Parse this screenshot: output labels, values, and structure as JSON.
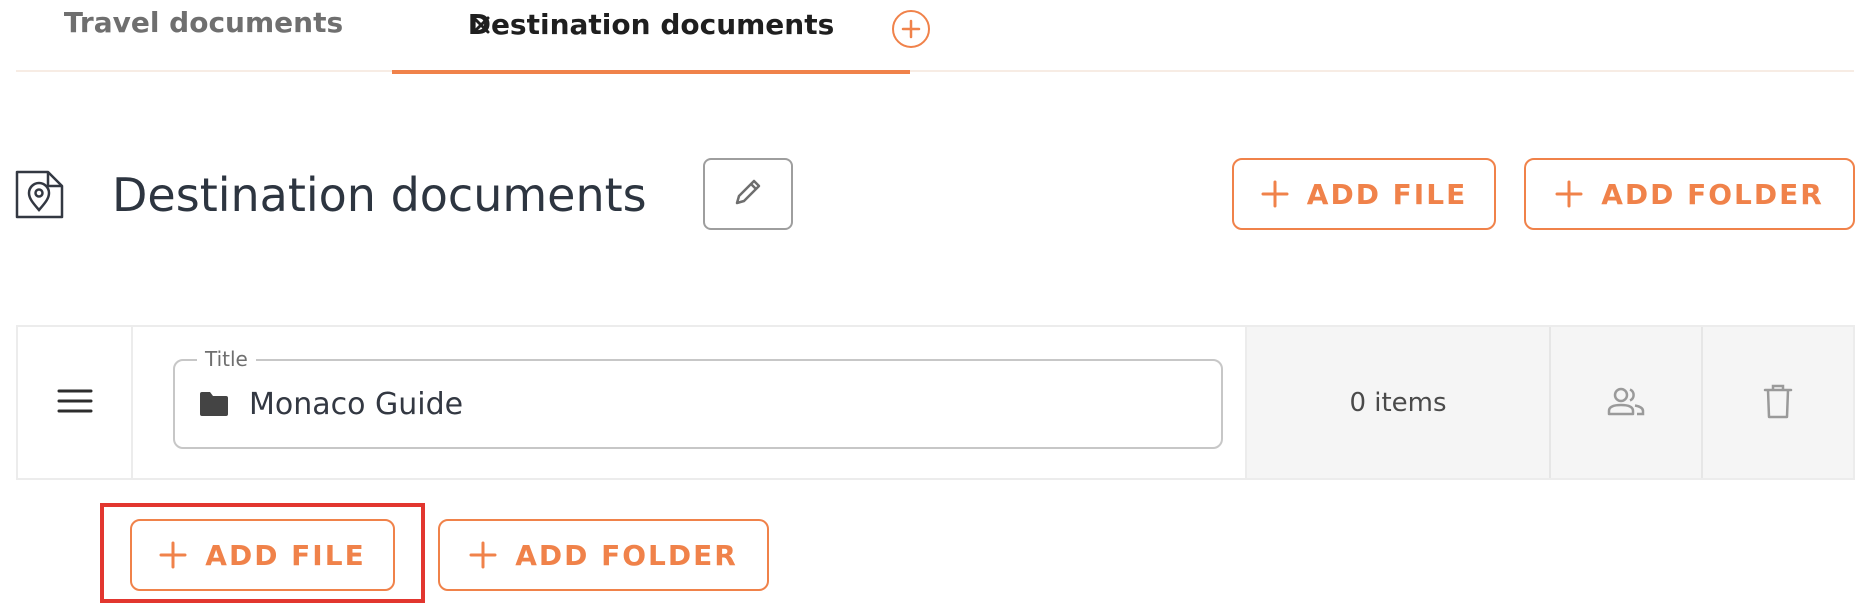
{
  "tabs": [
    {
      "label": "Travel documents",
      "active": false
    },
    {
      "label": "Destination documents",
      "active": true
    }
  ],
  "header": {
    "title": "Destination documents",
    "add_file_label": "ADD FILE",
    "add_folder_label": "ADD FOLDER"
  },
  "folder_row": {
    "field_label": "Title",
    "title_value": "Monaco Guide",
    "item_count": "0 items"
  },
  "footer": {
    "add_file_label": "ADD FILE",
    "add_folder_label": "ADD FOLDER",
    "highlighted": "add-file-button"
  },
  "colors": {
    "accent": "#f0824a",
    "highlight_box": "#e2362f",
    "text": "#333842"
  },
  "icons": [
    "close-icon",
    "add-tab-icon",
    "location-document-icon",
    "pencil-icon",
    "plus-icon",
    "drag-handle-icon",
    "folder-icon",
    "share-users-icon",
    "trash-icon"
  ]
}
